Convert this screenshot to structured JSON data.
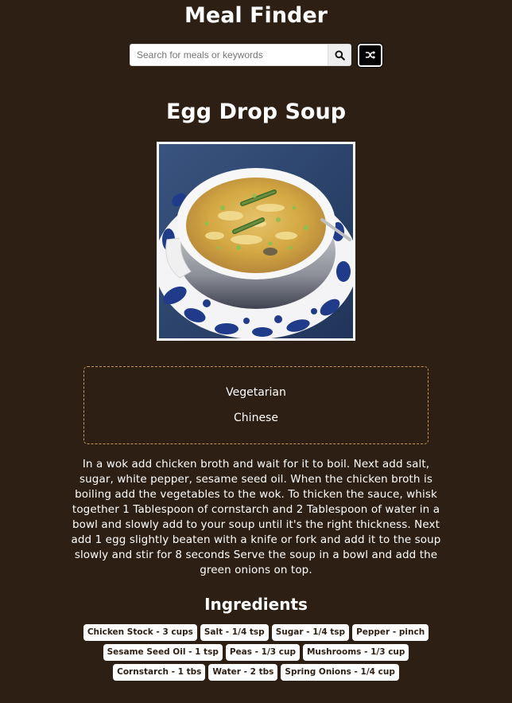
{
  "app": {
    "title": "Meal Finder"
  },
  "search": {
    "placeholder": "Search for meals or keywords",
    "value": "",
    "search_icon": "search-icon",
    "random_icon": "shuffle-icon"
  },
  "meal": {
    "title": "Egg Drop Soup",
    "image_alt": "Egg Drop Soup",
    "category": "Vegetarian",
    "area": "Chinese",
    "instructions": "In a wok add chicken broth and wait for it to boil. Next add salt, sugar, white pepper, sesame seed oil. When the chicken broth is boiling add the vegetables to the wok. To thicken the sauce, whisk together 1 Tablespoon of cornstarch and 2 Tablespoon of water in a bowl and slowly add to your soup until it's the right thickness. Next add 1 egg slightly beaten with a knife or fork and add it to the soup slowly and stir for 8 seconds Serve the soup in a bowl and add the green onions on top."
  },
  "ingredients": {
    "title": "Ingredients",
    "items": [
      "Chicken Stock - 3 cups",
      "Salt - 1/4 tsp",
      "Sugar - 1/4 tsp",
      "Pepper - pinch",
      "Sesame Seed Oil - 1 tsp",
      "Peas - 1/3 cup",
      "Mushrooms - 1/3 cup",
      "Cornstarch - 1 tbs",
      "Water - 2 tbs",
      "Spring Onions - 1/4 cup"
    ]
  },
  "colors": {
    "background": "#2d1f13",
    "text": "#ffffff",
    "category_border": "#c9955c",
    "ingredient_bg": "#ffffff"
  }
}
